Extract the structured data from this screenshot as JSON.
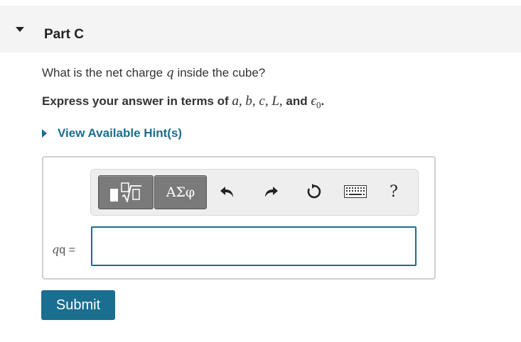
{
  "part": {
    "title": "Part C"
  },
  "question": {
    "prefix": "What is the net charge ",
    "variable": "q",
    "suffix": " inside the cube?"
  },
  "instruction": {
    "prefix": "Express your answer in terms of ",
    "terms": "a, b, c, L,",
    "and": " and ",
    "epsilon": "ϵ",
    "epsilon_sub": "0",
    "end": "."
  },
  "hint": {
    "label": "View Available Hint(s)"
  },
  "toolbar": {
    "greek_label": "ΑΣφ",
    "help_label": "?"
  },
  "answer": {
    "label_var": "q",
    "label_eq": "q =",
    "value": ""
  },
  "submit": {
    "label": "Submit"
  },
  "colors": {
    "accent": "#1a6e8f",
    "header_bg": "#f4f4f4",
    "toolbar_button": "#7a7a7a"
  },
  "icons": [
    "caret-down-icon",
    "caret-right-icon",
    "templates-icon",
    "undo-icon",
    "redo-icon",
    "reset-icon",
    "keyboard-icon",
    "help-icon"
  ]
}
